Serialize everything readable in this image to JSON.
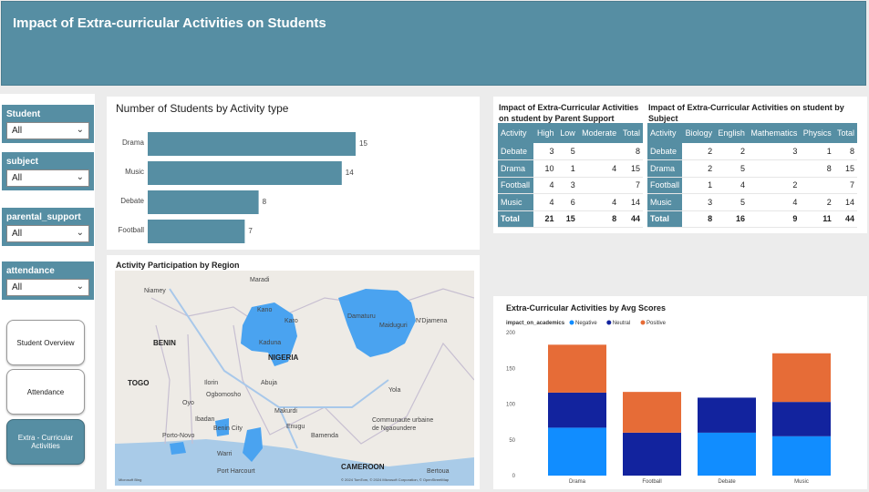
{
  "header": {
    "title": "Impact of Extra-curricular Activities on Students"
  },
  "slicers": [
    {
      "label": "Student",
      "value": "All"
    },
    {
      "label": "subject",
      "value": "All"
    },
    {
      "label": "parental_support",
      "value": "All"
    },
    {
      "label": "attendance",
      "value": "All"
    }
  ],
  "nav": [
    "Student Overview",
    "Attendance",
    "Extra - Curricular Activities"
  ],
  "bar_title": "Number of Students by Activity type",
  "map": {
    "title": "Activity Participation by Region",
    "labels": [
      "Niamey",
      "Maradi",
      "Kano",
      "Karo",
      "Damaturu",
      "Maiduguri",
      "N'Djamena",
      "BENIN",
      "NIGERIA",
      "Kaduna",
      "TOGO",
      "Ilorin",
      "Abuja",
      "Ogbomosho",
      "Oyo",
      "Ibadan",
      "Benin City",
      "Enugu",
      "Makurdi",
      "Yola",
      "Bamenda",
      "Porto-Novo",
      "Port Harcourt",
      "CAMEROON",
      "Communaute urbaine de Ngaoundere",
      "Warri",
      "Bertoua"
    ],
    "attribution": "© 2024 TomTom, © 2024 Microsoft Corporation, © OpenStreetMap",
    "logo": "Microsoft Bing"
  },
  "parent_table": {
    "title": "Impact of Extra-Curricular Activities on student by Parent Support",
    "headers": [
      "Activity",
      "High",
      "Low",
      "Moderate",
      "Total"
    ],
    "rows": [
      [
        "Debate",
        "3",
        "5",
        "",
        "8"
      ],
      [
        "Drama",
        "10",
        "1",
        "4",
        "15"
      ],
      [
        "Football",
        "4",
        "3",
        "",
        "7"
      ],
      [
        "Music",
        "4",
        "6",
        "4",
        "14"
      ]
    ],
    "total": [
      "Total",
      "21",
      "15",
      "8",
      "44"
    ]
  },
  "subject_table": {
    "title": "Impact of Extra-Curricular Activities on student by Subject",
    "headers": [
      "Activity",
      "Biology",
      "English",
      "Mathematics",
      "Physics",
      "Total"
    ],
    "rows": [
      [
        "Debate",
        "2",
        "2",
        "3",
        "1",
        "8"
      ],
      [
        "Drama",
        "2",
        "5",
        "",
        "8",
        "15"
      ],
      [
        "Football",
        "1",
        "4",
        "2",
        "",
        "7"
      ],
      [
        "Music",
        "3",
        "5",
        "4",
        "2",
        "14"
      ]
    ],
    "total": [
      "Total",
      "8",
      "16",
      "9",
      "11",
      "44"
    ]
  },
  "chart_data": [
    {
      "type": "bar",
      "title": "Number of Students by Activity type",
      "categories": [
        "Drama",
        "Music",
        "Debate",
        "Football"
      ],
      "values": [
        15,
        14,
        8,
        7
      ],
      "orientation": "horizontal",
      "color": "#568ea3"
    },
    {
      "type": "bar",
      "stacked": true,
      "title": "Extra-Curricular Activities by Avg Scores",
      "legend_title": "impact_on_academics",
      "categories": [
        "Drama",
        "Football",
        "Debate",
        "Music"
      ],
      "series": [
        {
          "name": "Negative",
          "color": "#118dff",
          "values": [
            67,
            0,
            60,
            55
          ]
        },
        {
          "name": "Neutral",
          "color": "#12239e",
          "values": [
            49,
            60,
            49,
            48
          ]
        },
        {
          "name": "Positive",
          "color": "#e66c37",
          "values": [
            67,
            57,
            0,
            68
          ]
        }
      ],
      "ylim": [
        0,
        200
      ],
      "yticks": [
        0,
        50,
        100,
        150,
        200
      ],
      "legend": "top-left"
    }
  ]
}
